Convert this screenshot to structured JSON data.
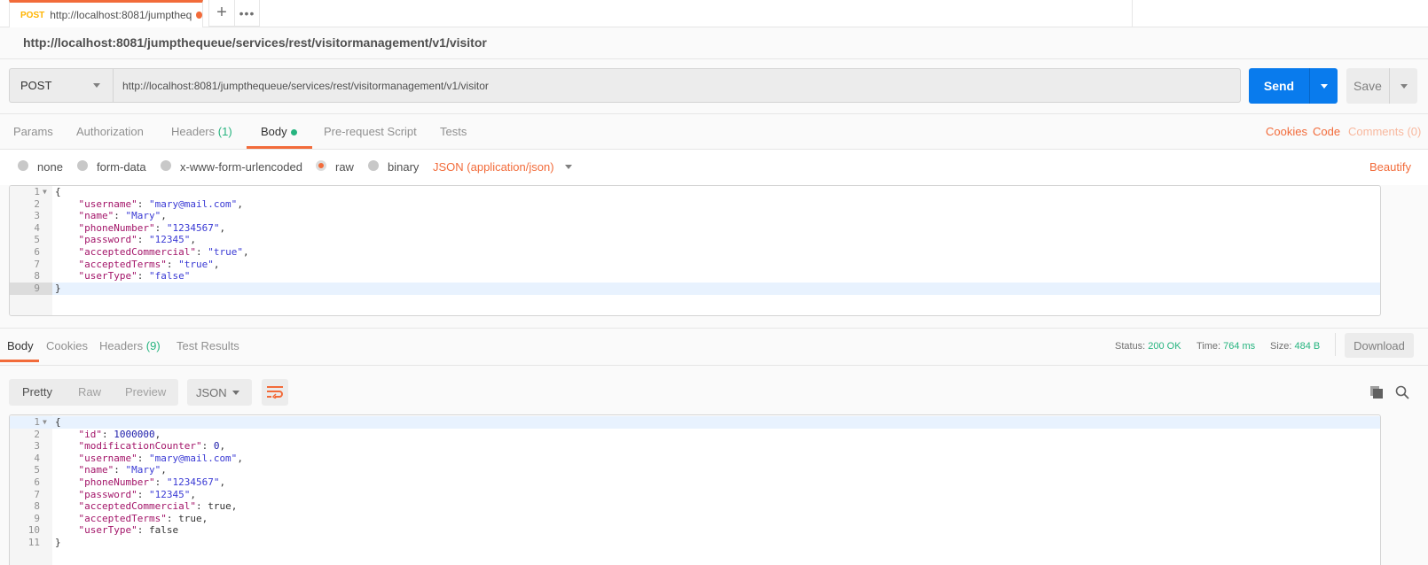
{
  "tab": {
    "method": "POST",
    "title": "http://localhost:8081/jumptheq",
    "add_label": "+",
    "more_label": "•••"
  },
  "request": {
    "name": "http://localhost:8081/jumpthequeue/services/rest/visitormanagement/v1/visitor",
    "method": "POST",
    "url": "http://localhost:8081/jumpthequeue/services/rest/visitormanagement/v1/visitor",
    "send_label": "Send",
    "save_label": "Save"
  },
  "request_tabs": {
    "params": "Params",
    "authorization": "Authorization",
    "headers": "Headers",
    "headers_count": "(1)",
    "body": "Body",
    "prerequest": "Pre-request Script",
    "tests": "Tests",
    "cookies": "Cookies",
    "code": "Code",
    "comments": "Comments (0)"
  },
  "body_types": {
    "none": "none",
    "form_data": "form-data",
    "urlencoded": "x-www-form-urlencoded",
    "raw": "raw",
    "binary": "binary",
    "selected": "raw",
    "content_type": "JSON (application/json)",
    "beautify": "Beautify"
  },
  "request_body": [
    {
      "n": "1",
      "tokens": [
        {
          "t": "{",
          "c": "b"
        }
      ]
    },
    {
      "n": "2",
      "tokens": [
        {
          "t": "    \"username\"",
          "c": "k"
        },
        {
          "t": ": ",
          "c": "b"
        },
        {
          "t": "\"mary@mail.com\"",
          "c": "s"
        },
        {
          "t": ",",
          "c": "b"
        }
      ]
    },
    {
      "n": "3",
      "tokens": [
        {
          "t": "    \"name\"",
          "c": "k"
        },
        {
          "t": ": ",
          "c": "b"
        },
        {
          "t": "\"Mary\"",
          "c": "s"
        },
        {
          "t": ",",
          "c": "b"
        }
      ]
    },
    {
      "n": "4",
      "tokens": [
        {
          "t": "    \"phoneNumber\"",
          "c": "k"
        },
        {
          "t": ": ",
          "c": "b"
        },
        {
          "t": "\"1234567\"",
          "c": "s"
        },
        {
          "t": ",",
          "c": "b"
        }
      ]
    },
    {
      "n": "5",
      "tokens": [
        {
          "t": "    \"password\"",
          "c": "k"
        },
        {
          "t": ": ",
          "c": "b"
        },
        {
          "t": "\"12345\"",
          "c": "s"
        },
        {
          "t": ",",
          "c": "b"
        }
      ]
    },
    {
      "n": "6",
      "tokens": [
        {
          "t": "    \"acceptedCommercial\"",
          "c": "k"
        },
        {
          "t": ": ",
          "c": "b"
        },
        {
          "t": "\"true\"",
          "c": "s"
        },
        {
          "t": ",",
          "c": "b"
        }
      ]
    },
    {
      "n": "7",
      "tokens": [
        {
          "t": "    \"acceptedTerms\"",
          "c": "k"
        },
        {
          "t": ": ",
          "c": "b"
        },
        {
          "t": "\"true\"",
          "c": "s"
        },
        {
          "t": ",",
          "c": "b"
        }
      ]
    },
    {
      "n": "8",
      "tokens": [
        {
          "t": "    \"userType\"",
          "c": "k"
        },
        {
          "t": ": ",
          "c": "b"
        },
        {
          "t": "\"false\"",
          "c": "s"
        }
      ]
    },
    {
      "n": "9",
      "tokens": [
        {
          "t": "}",
          "c": "b"
        }
      ]
    }
  ],
  "response_tabs": {
    "body": "Body",
    "cookies": "Cookies",
    "headers": "Headers",
    "headers_count": "(9)",
    "test_results": "Test Results"
  },
  "response_meta": {
    "status_label": "Status:",
    "status": "200 OK",
    "time_label": "Time:",
    "time": "764 ms",
    "size_label": "Size:",
    "size": "484 B",
    "download_label": "Download"
  },
  "response_view": {
    "pretty": "Pretty",
    "raw": "Raw",
    "preview": "Preview",
    "format": "JSON"
  },
  "response_body": [
    {
      "n": "1",
      "tokens": [
        {
          "t": "{",
          "c": "b"
        }
      ]
    },
    {
      "n": "2",
      "tokens": [
        {
          "t": "    \"id\"",
          "c": "k"
        },
        {
          "t": ": ",
          "c": "b"
        },
        {
          "t": "1000000",
          "c": "n"
        },
        {
          "t": ",",
          "c": "b"
        }
      ]
    },
    {
      "n": "3",
      "tokens": [
        {
          "t": "    \"modificationCounter\"",
          "c": "k"
        },
        {
          "t": ": ",
          "c": "b"
        },
        {
          "t": "0",
          "c": "n"
        },
        {
          "t": ",",
          "c": "b"
        }
      ]
    },
    {
      "n": "4",
      "tokens": [
        {
          "t": "    \"username\"",
          "c": "k"
        },
        {
          "t": ": ",
          "c": "b"
        },
        {
          "t": "\"mary@mail.com\"",
          "c": "s"
        },
        {
          "t": ",",
          "c": "b"
        }
      ]
    },
    {
      "n": "5",
      "tokens": [
        {
          "t": "    \"name\"",
          "c": "k"
        },
        {
          "t": ": ",
          "c": "b"
        },
        {
          "t": "\"Mary\"",
          "c": "s"
        },
        {
          "t": ",",
          "c": "b"
        }
      ]
    },
    {
      "n": "6",
      "tokens": [
        {
          "t": "    \"phoneNumber\"",
          "c": "k"
        },
        {
          "t": ": ",
          "c": "b"
        },
        {
          "t": "\"1234567\"",
          "c": "s"
        },
        {
          "t": ",",
          "c": "b"
        }
      ]
    },
    {
      "n": "7",
      "tokens": [
        {
          "t": "    \"password\"",
          "c": "k"
        },
        {
          "t": ": ",
          "c": "b"
        },
        {
          "t": "\"12345\"",
          "c": "s"
        },
        {
          "t": ",",
          "c": "b"
        }
      ]
    },
    {
      "n": "8",
      "tokens": [
        {
          "t": "    \"acceptedCommercial\"",
          "c": "k"
        },
        {
          "t": ": ",
          "c": "b"
        },
        {
          "t": "true",
          "c": "b"
        },
        {
          "t": ",",
          "c": "b"
        }
      ]
    },
    {
      "n": "9",
      "tokens": [
        {
          "t": "    \"acceptedTerms\"",
          "c": "k"
        },
        {
          "t": ": ",
          "c": "b"
        },
        {
          "t": "true",
          "c": "b"
        },
        {
          "t": ",",
          "c": "b"
        }
      ]
    },
    {
      "n": "10",
      "tokens": [
        {
          "t": "    \"userType\"",
          "c": "k"
        },
        {
          "t": ": ",
          "c": "b"
        },
        {
          "t": "false",
          "c": "b"
        }
      ]
    },
    {
      "n": "11",
      "tokens": [
        {
          "t": "}",
          "c": "b"
        }
      ]
    }
  ],
  "colors": {
    "accent": "#f26b3a",
    "send": "#097bed",
    "success": "#26b47f",
    "method_post": "#ffb400"
  }
}
